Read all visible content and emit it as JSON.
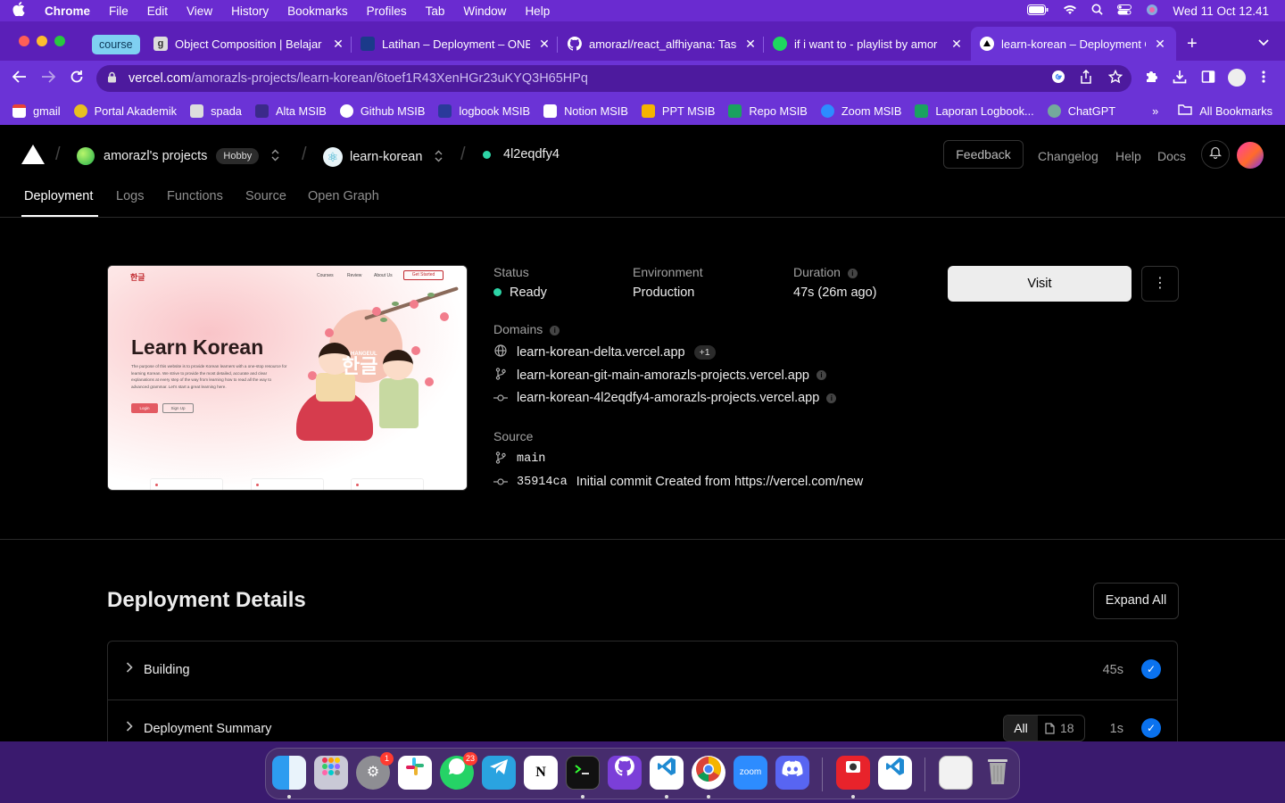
{
  "menubar": {
    "app": "Chrome",
    "items": [
      "File",
      "Edit",
      "View",
      "History",
      "Bookmarks",
      "Profiles",
      "Tab",
      "Window",
      "Help"
    ],
    "clock": "Wed 11 Oct  12.41"
  },
  "tabs": {
    "group_label": "course",
    "items": [
      {
        "title": "Object Composition | Belajar"
      },
      {
        "title": "Latihan – Deployment – ONE"
      },
      {
        "title": "amorazl/react_alfhiyana: Tas"
      },
      {
        "title": "if i want to - playlist by amor"
      },
      {
        "title": "learn-korean – Deployment O"
      }
    ],
    "new_tab": "+"
  },
  "omnibox": {
    "host": "vercel.com",
    "path": "/amorazls-projects/learn-korean/6toef1R43XenHGr23uKYQ3H65HPq"
  },
  "bookmarks": {
    "items": [
      "gmail",
      "Portal Akademik",
      "spada",
      "Alta MSIB",
      "Github MSIB",
      "logbook MSIB",
      "Notion MSIB",
      "PPT MSIB",
      "Repo MSIB",
      "Zoom MSIB",
      "Laporan Logbook...",
      "ChatGPT"
    ],
    "overflow": "»",
    "all_bookmarks": "All Bookmarks"
  },
  "vercel": {
    "team": "amorazl's projects",
    "plan": "Hobby",
    "project": "learn-korean",
    "deployment_id": "4l2eqdfy4",
    "feedback": "Feedback",
    "links": [
      "Changelog",
      "Help",
      "Docs"
    ],
    "nav": [
      "Deployment",
      "Logs",
      "Functions",
      "Source",
      "Open Graph"
    ]
  },
  "preview": {
    "logo": "한글",
    "nav": [
      "Courses",
      "Review",
      "About Us"
    ],
    "cta": "Get Started",
    "title": "Learn Korean",
    "body": "The purpose of this website is to provide Korean learners with a one-stop resource for learning Korean. We strive to provide the most detailed, accurate and clear explanations at every step of the way from learning how to read all the way to advanced grammar. Let's start a great learning here.",
    "login": "Login",
    "signup": "Sign Up",
    "hangeul": "HANGEUL",
    "hangul": "한글"
  },
  "deployment": {
    "status_label": "Status",
    "status": "Ready",
    "env_label": "Environment",
    "env": "Production",
    "duration_label": "Duration",
    "duration": "47s (26m ago)",
    "domains_label": "Domains",
    "domains": [
      "learn-korean-delta.vercel.app",
      "learn-korean-git-main-amorazls-projects.vercel.app",
      "learn-korean-4l2eqdfy4-amorazls-projects.vercel.app"
    ],
    "domain_extra": "+1",
    "source_label": "Source",
    "branch": "main",
    "commit_hash": "35914ca",
    "commit_msg": "Initial commit Created from https://vercel.com/new",
    "visit": "Visit"
  },
  "details": {
    "title": "Deployment Details",
    "expand_all": "Expand All",
    "rows": [
      {
        "label": "Building",
        "duration": "45s"
      },
      {
        "label": "Deployment Summary",
        "duration": "1s",
        "filter": "All",
        "file_count": "18"
      }
    ]
  },
  "dock": {
    "badges": {
      "settings": "1",
      "whatsapp": "23"
    },
    "zoom_label": "zoom"
  },
  "colors": {
    "menubar": "#6a2bd0",
    "chrome_frame": "#6b33d6",
    "vercel_bg": "#000000",
    "ready": "#2dd4a6",
    "check_blue": "#0a72ef"
  }
}
